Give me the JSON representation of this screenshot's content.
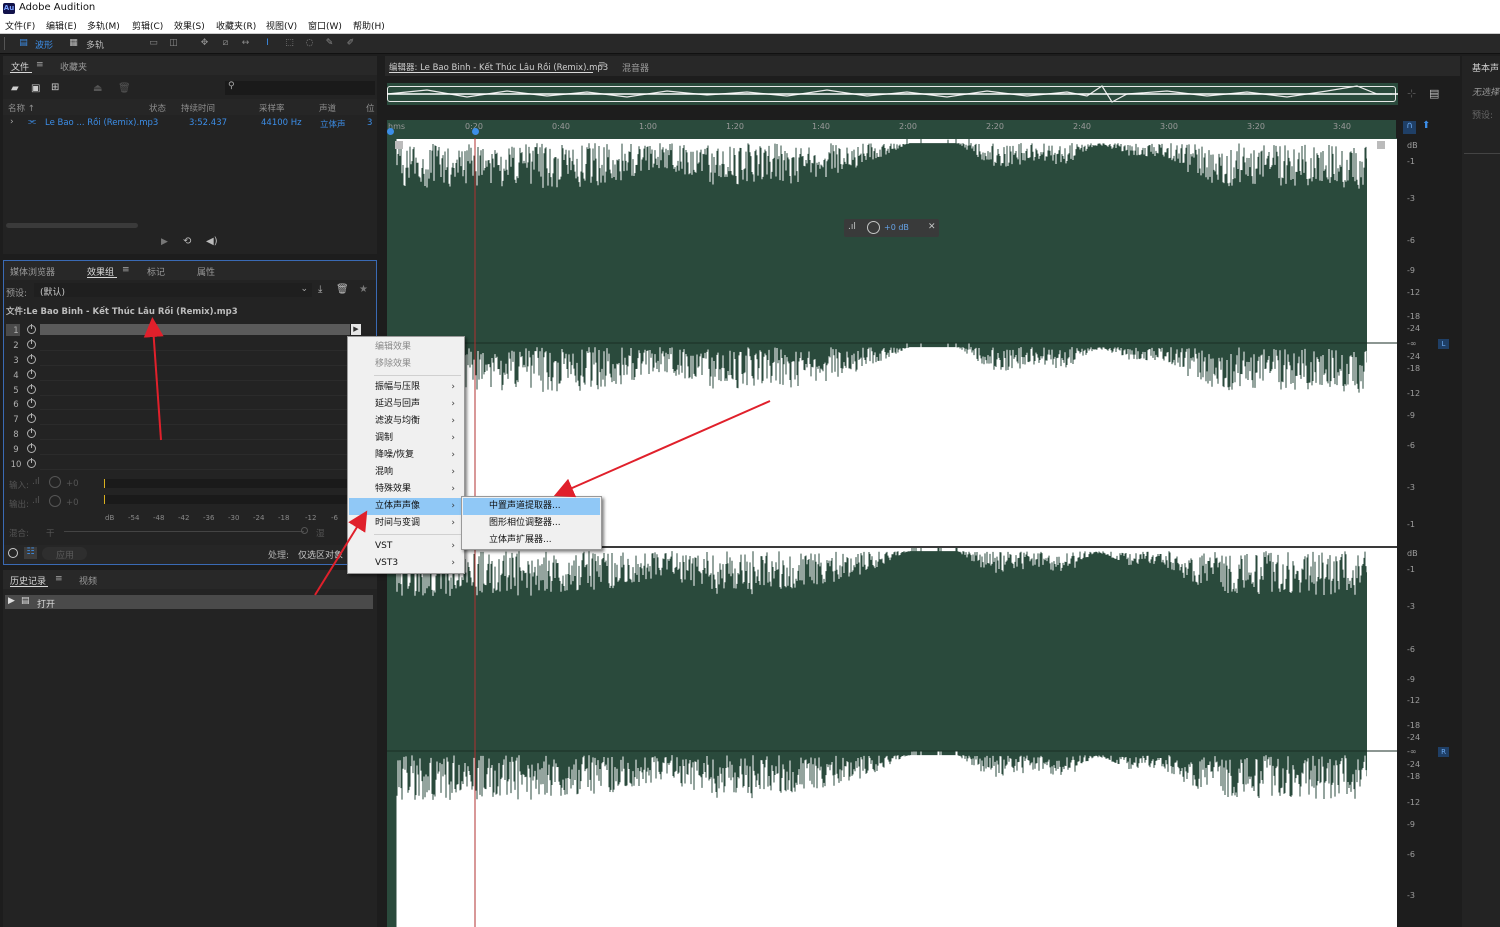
{
  "app": {
    "logo": "Au",
    "title": "Adobe Audition"
  },
  "menu": [
    "文件(F)",
    "编辑(E)",
    "多轨(M)",
    "剪辑(C)",
    "效果(S)",
    "收藏夹(R)",
    "视图(V)",
    "窗口(W)",
    "帮助(H)"
  ],
  "toolbar": {
    "waveform": "波形",
    "multitrack": "多轨"
  },
  "files_panel": {
    "tab_files": "文件",
    "tab_favorites": "收藏夹",
    "search_icon": "search-icon",
    "columns": [
      "名称 ↑",
      "状态",
      "持续时间",
      "采样率",
      "声道",
      "位"
    ],
    "file": {
      "name": "Le Bao ... Rồi (Remix).mp3",
      "duration": "3:52.437",
      "sample_rate": "44100 Hz",
      "channels": "立体声",
      "bit": "3"
    }
  },
  "effects_panel": {
    "tabs": [
      "媒体浏览器",
      "效果组",
      "标记",
      "属性"
    ],
    "preset_label": "预设:",
    "preset_value": "(默认)",
    "file_label": "文件:Le Bao Binh - Kết Thúc Lâu Rồi (Remix).mp3",
    "slots": [
      "1",
      "2",
      "3",
      "4",
      "5",
      "6",
      "7",
      "8",
      "9",
      "10"
    ],
    "input_label": "输入:",
    "output_label": "输出:",
    "input_gain": "+0",
    "output_gain": "+0",
    "meter_scale": [
      "dB",
      "-54",
      "-48",
      "-42",
      "-36",
      "-30",
      "-24",
      "-18",
      "-12",
      "-6"
    ],
    "mix_label": "混合:",
    "mix_dry": "干",
    "mix_wet": "湿",
    "apply_button": "应用",
    "process_label": "处理:",
    "process_value": "仅选区对象"
  },
  "history_panel": {
    "tabs": [
      "历史记录",
      "视频"
    ],
    "item": "打开"
  },
  "context_menu": {
    "items": [
      {
        "label": "编辑效果",
        "disabled": true
      },
      {
        "label": "移除效果",
        "disabled": true
      },
      {
        "label": "振幅与压限"
      },
      {
        "label": "延迟与回声"
      },
      {
        "label": "滤波与均衡"
      },
      {
        "label": "调制"
      },
      {
        "label": "降噪/恢复"
      },
      {
        "label": "混响"
      },
      {
        "label": "特殊效果"
      },
      {
        "label": "立体声声像",
        "highlighted": true
      },
      {
        "label": "时间与变调"
      },
      {
        "label": "VST"
      },
      {
        "label": "VST3"
      }
    ],
    "submenu": [
      "中置声道提取器...",
      "图形相位调整器...",
      "立体声扩展器..."
    ]
  },
  "editor": {
    "tab_editor": "编辑器: Le Bao Binh - Kết Thúc Lâu Rồi (Remix).mp3",
    "tab_mixer": "混音器",
    "ruler_unit": "hms",
    "ruler": [
      "0:20",
      "0:40",
      "1:00",
      "1:20",
      "1:40",
      "2:00",
      "2:20",
      "2:40",
      "3:00",
      "3:20",
      "3:40"
    ],
    "hud_gain": "+0 dB",
    "channel_left": "L",
    "channel_right": "R",
    "db_unit": "dB",
    "db_scale_top": [
      "-1",
      "-3",
      "-6",
      "-9",
      "-12",
      "-18",
      "-24",
      "-∞"
    ],
    "db_scale_bottom": [
      "-24",
      "-18",
      "-12",
      "-9",
      "-6",
      "-3",
      "-1"
    ]
  },
  "right_panel": {
    "title": "基本声",
    "line1": "无选择",
    "line2": "预设:"
  },
  "colors": {
    "waveform_bg": "#2a4a3c",
    "accent_blue": "#3c8ee8",
    "highlight": "#90c8f6",
    "arrow": "#e0202b"
  }
}
